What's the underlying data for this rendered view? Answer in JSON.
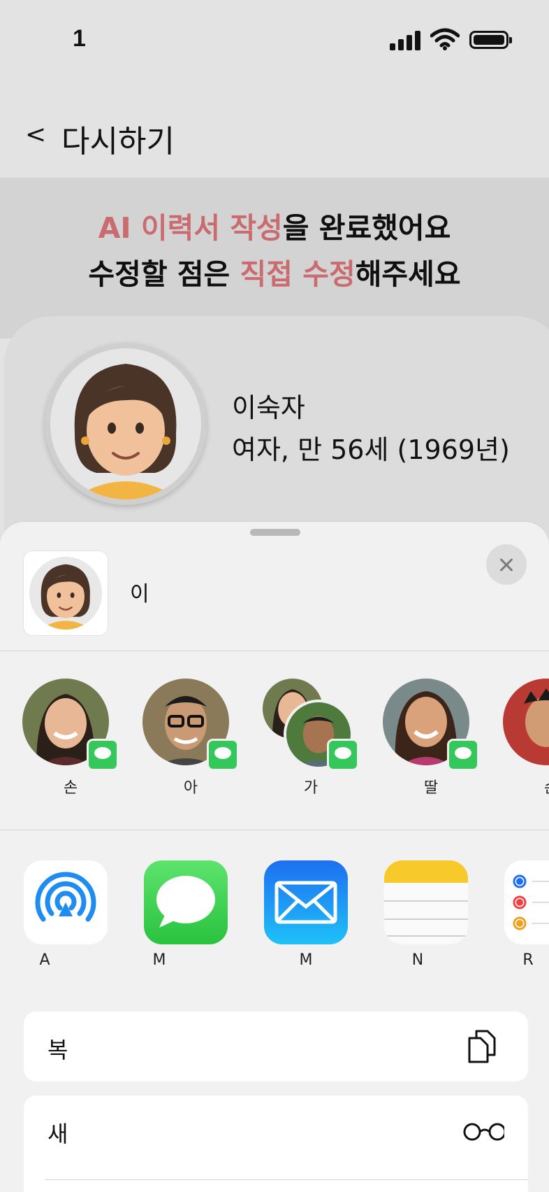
{
  "status_bar": {
    "time": "1"
  },
  "nav": {
    "back_icon": "chevron-left-icon",
    "title": "다시하기"
  },
  "headline": {
    "line1_accent": "AI 이력서 작성",
    "line1_rest": "을 완료했어요",
    "line2_lead": "수정할 점은 ",
    "line2_accent": "직접 수정",
    "line2_rest": "해주세요",
    "accent_color": "#c96b6f"
  },
  "profile": {
    "name": "이숙자",
    "meta": "여자, 만 56세 (1969년)",
    "avatar_icon": "woman-avatar-icon"
  },
  "share_sheet": {
    "preview_title": "이",
    "close_icon": "close-icon",
    "contacts": [
      {
        "label": "손",
        "badge_icon": "messages-badge-icon"
      },
      {
        "label": "아",
        "badge_icon": "messages-badge-icon"
      },
      {
        "label": "가",
        "badge_icon": "messages-badge-icon"
      },
      {
        "label": "딸",
        "badge_icon": "messages-badge-icon"
      },
      {
        "label": "손"
      }
    ],
    "apps": [
      {
        "label": "A",
        "icon": "airdrop-icon"
      },
      {
        "label": "M",
        "icon": "messages-icon"
      },
      {
        "label": "M",
        "icon": "mail-icon"
      },
      {
        "label": "N",
        "icon": "notes-icon"
      },
      {
        "label": "R",
        "icon": "reminders-icon"
      }
    ],
    "actions": [
      {
        "label": "복",
        "icon": "copy-icon"
      },
      {
        "label": "새",
        "icon": "reading-glasses-icon"
      }
    ]
  }
}
